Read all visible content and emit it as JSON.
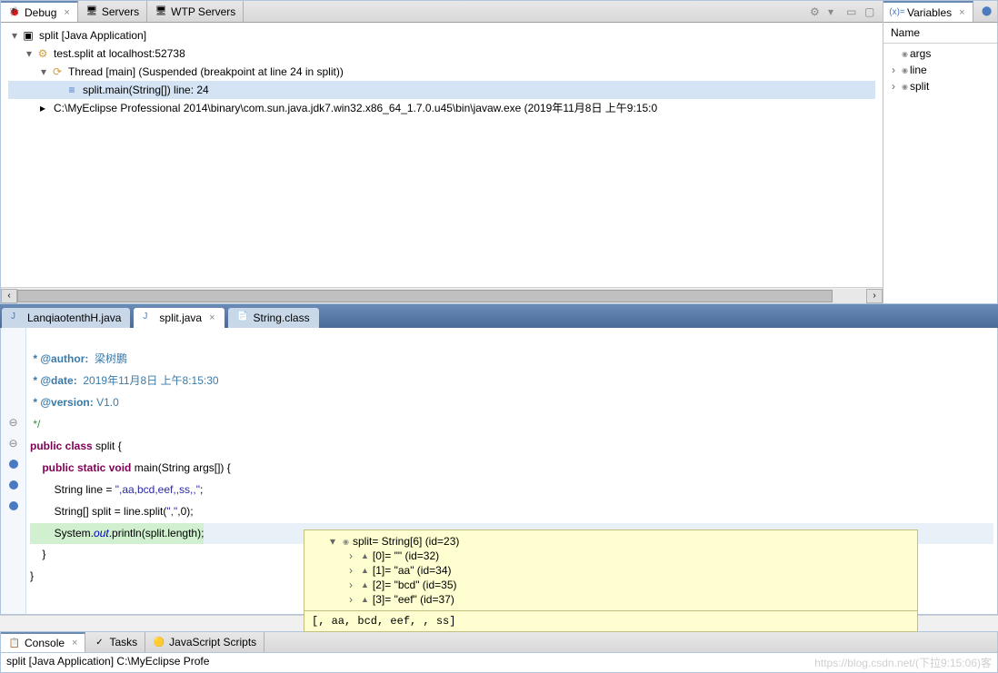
{
  "debug_view": {
    "tabs": [
      {
        "icon": "🐞",
        "label": "Debug",
        "active": true
      },
      {
        "icon": "🖥",
        "label": "Servers",
        "active": false
      },
      {
        "icon": "🖥",
        "label": "WTP Servers",
        "active": false
      }
    ],
    "tree": {
      "root": "split [Java Application]",
      "process": "test.split at localhost:52738",
      "thread": "Thread [main] (Suspended (breakpoint at line 24 in split))",
      "frame": "split.main(String[]) line: 24",
      "exe": "C:\\MyEclipse Professional 2014\\binary\\com.sun.java.jdk7.win32.x86_64_1.7.0.u45\\bin\\javaw.exe (2019年11月8日 上午9:15:0"
    }
  },
  "variables_view": {
    "tab_label": "Variables",
    "header": "Name",
    "items": [
      "args",
      "line",
      "split"
    ]
  },
  "editor_tabs": [
    {
      "icon": "J",
      "label": "LanqiaotenthH.java",
      "active": false
    },
    {
      "icon": "J",
      "label": "split.java",
      "active": true
    },
    {
      "icon": "📄",
      "label": "String.class",
      "active": false
    }
  ],
  "code": {
    "doc_author_tag": " * @author:",
    "doc_author_val": "  梁树鹏",
    "doc_date_tag": " * @date:",
    "doc_date_val": "  2019年11月8日 上午8:15:30",
    "doc_version_tag": " * @version:",
    "doc_version_val": " V1.0",
    "doc_end": " */",
    "class_decl_pre": "public class ",
    "class_name": "split",
    "class_open": " {",
    "main_indent": "    ",
    "main_mods": "public static void ",
    "main_name": "main",
    "main_params": "(String args[]) {",
    "line1_indent": "        String line = ",
    "line1_str": "\",aa,bcd,eef,,ss,,\"",
    "line1_end": ";",
    "line2_indent": "        String[] split = line.split(",
    "line2_str": "\",\"",
    "line2_mid": ",0);",
    "line3_indent": "        System.",
    "line3_out": "out",
    "line3_print": ".println(split.length);",
    "close1": "    }",
    "close2": "}"
  },
  "hover": {
    "root": "split= String[6]  (id=23)",
    "items": [
      "[0]= \"\" (id=32)",
      "[1]= \"aa\" (id=34)",
      "[2]= \"bcd\" (id=35)",
      "[3]= \"eef\" (id=37)"
    ],
    "footer": "[, aa, bcd, eef, , ss]"
  },
  "bottom_tabs": [
    {
      "icon": "📋",
      "label": "Console",
      "active": true
    },
    {
      "icon": "✓",
      "label": "Tasks",
      "active": false
    },
    {
      "icon": "JS",
      "label": "JavaScript Scripts",
      "active": false
    }
  ],
  "console_text": "split [Java Application] C:\\MyEclipse Profe",
  "watermark": "https://blog.csdn.net/(下拉9:15:06)客"
}
